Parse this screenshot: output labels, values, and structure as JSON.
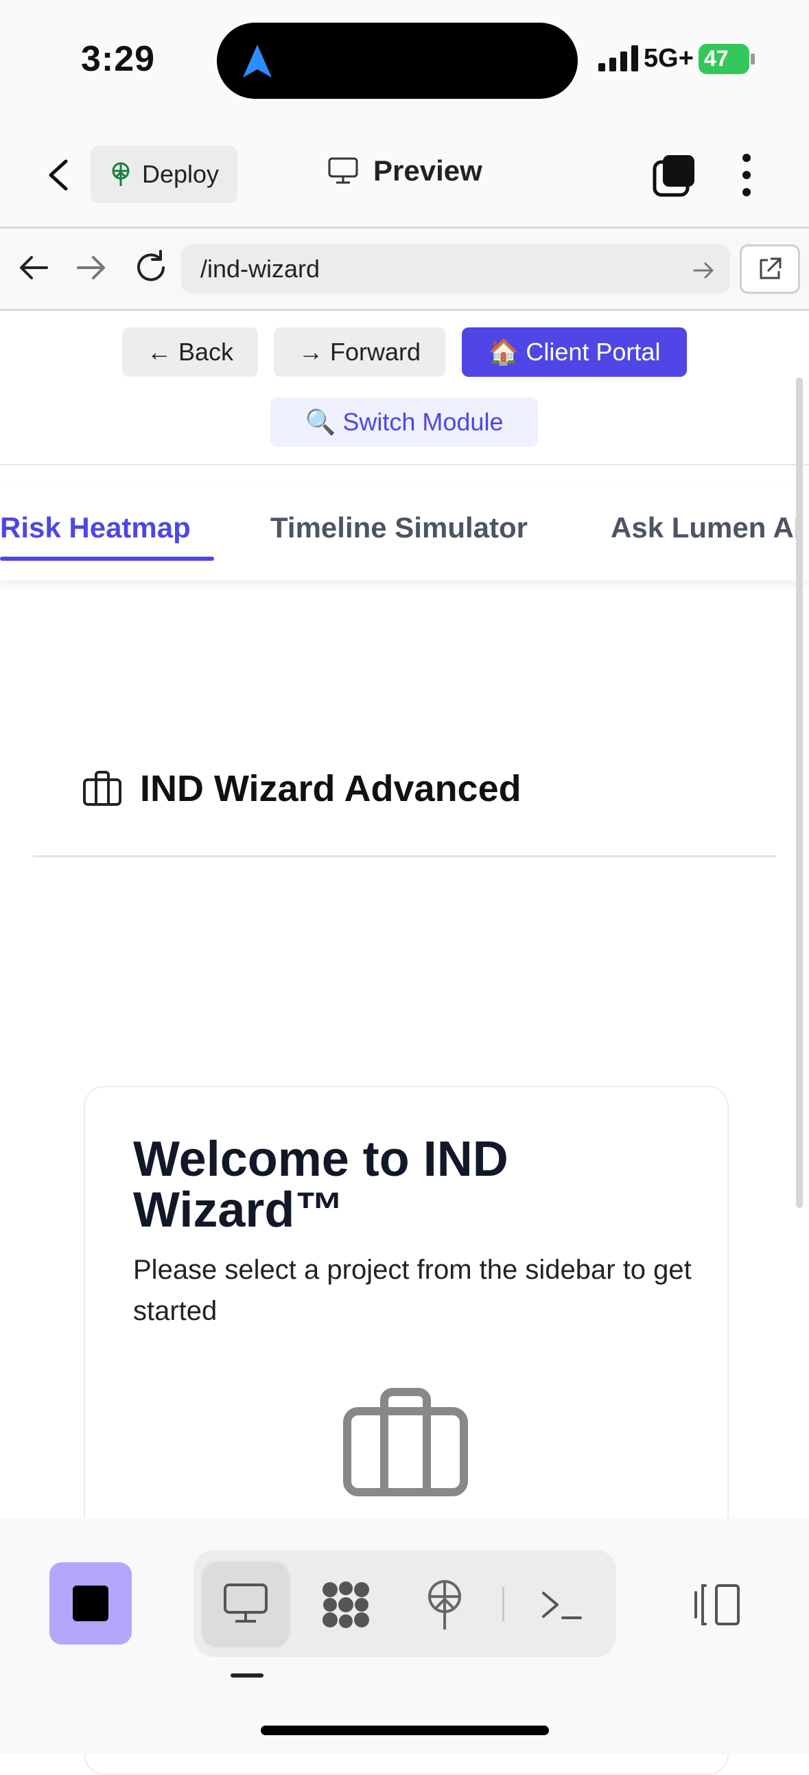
{
  "status_bar": {
    "time": "3:29",
    "network": "5G+",
    "battery": "47"
  },
  "app_header": {
    "deploy_label": "Deploy",
    "preview_label": "Preview"
  },
  "browser": {
    "url": "/ind-wizard"
  },
  "page_nav": {
    "back_label": "← Back",
    "forward_label": "→ Forward",
    "portal_label": "🏠 Client Portal",
    "switch_label": "🔍 Switch Module"
  },
  "tabs": [
    {
      "label": "Risk Heatmap",
      "active": true
    },
    {
      "label": "Timeline Simulator",
      "active": false
    },
    {
      "label": "Ask Lumen AI",
      "active": false
    }
  ],
  "section": {
    "title": "IND Wizard Advanced"
  },
  "welcome": {
    "title": "Welcome to IND Wizard™",
    "text": "Please select a project from the sidebar to get started"
  },
  "colors": {
    "accent": "#4f46e5",
    "stop_button": "#b6a6fb",
    "battery_green": "#34c759"
  },
  "toolbar_icons": [
    "stop-icon",
    "monitor-icon",
    "grid-icon",
    "deploy-icon",
    "terminal-icon",
    "split-view-icon"
  ]
}
